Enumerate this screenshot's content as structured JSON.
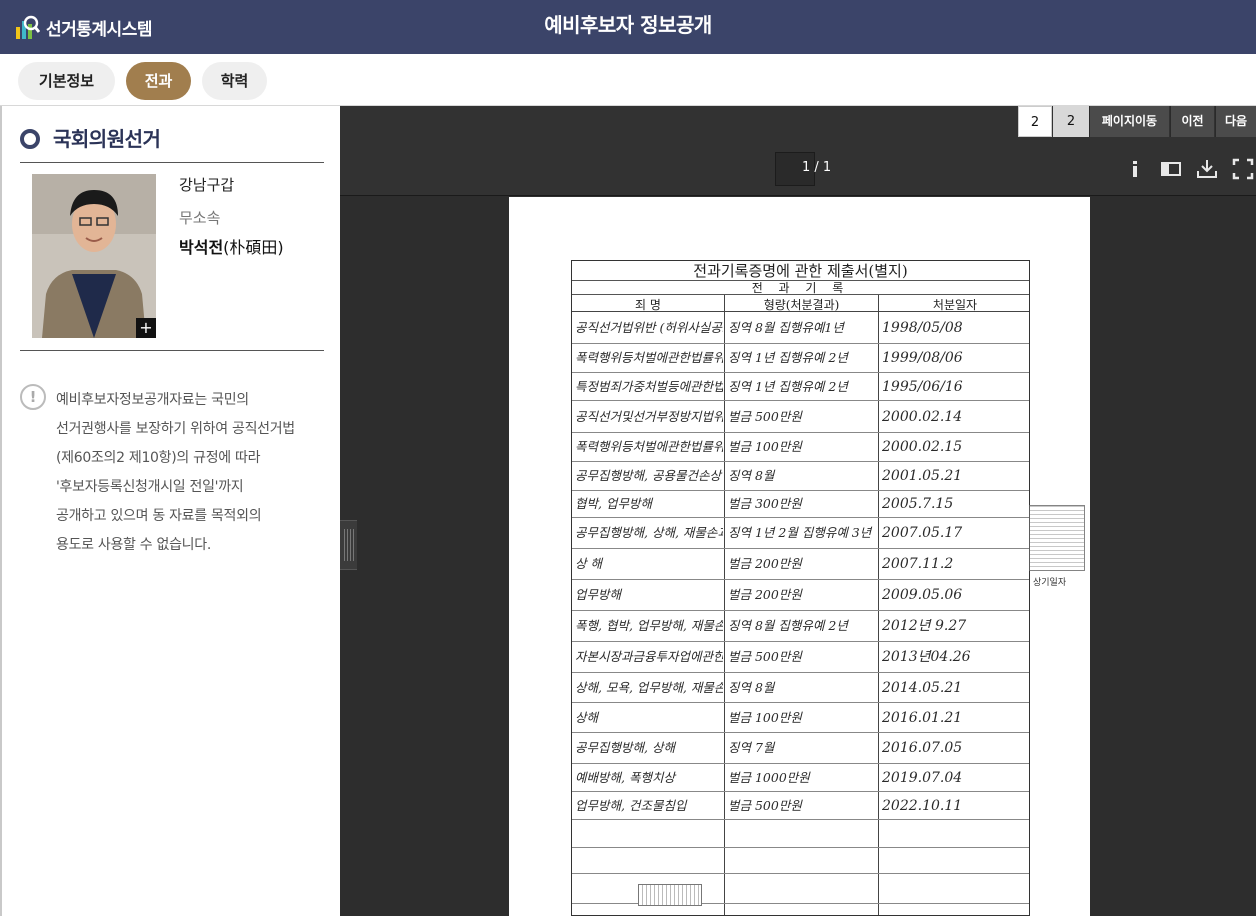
{
  "app": {
    "logo_text": "선거통계시스템",
    "page_title": "예비후보자 정보공개"
  },
  "tabs": [
    {
      "label": "기본정보",
      "active": false
    },
    {
      "label": "전과",
      "active": true
    },
    {
      "label": "학력",
      "active": false
    }
  ],
  "colors": {
    "header_bg": "#3b4469",
    "tab_active": "#a17e4e",
    "viewer_bg": "#2d2d2d"
  },
  "candidate": {
    "election": "국회의원선거",
    "district": "강남구갑",
    "party": "무소속",
    "name": "박석전",
    "name_hanja": "(朴碩田)",
    "photo_icon": "plus-icon"
  },
  "notice": {
    "icon": "exclamation-icon",
    "lines": [
      "예비후보자정보공개자료는 국민의",
      "선거권행사를 보장하기 위하여 공직선거법",
      "(제60조의2 제10항)의 규정에 따라",
      "'후보자등록신청개시일 전일'까지",
      "공개하고 있으며 동 자료를 목적외의",
      "용도로 사용할 수 없습니다."
    ]
  },
  "viewer": {
    "page_input": "2",
    "page_total": "2",
    "goto_label": "페이지이동",
    "prev_label": "이전",
    "next_label": "다음",
    "page_indicator": "1 / 1",
    "tools": [
      "info-icon",
      "sidebar-toggle-icon",
      "download-icon",
      "fullscreen-icon"
    ]
  },
  "document": {
    "title": "전과기록증명에 관한 제출서(별지)",
    "subtitle": "전 과 기 록",
    "columns": [
      "죄 명",
      "형량(처분결과)",
      "처분일자"
    ],
    "rows": [
      {
        "crime": "공직선거법위반 (허위사실공표)",
        "sentence": "징역 8월 집행유예1년",
        "date": "1998/05/08"
      },
      {
        "crime": "폭력행위등처벌에관한법률위반",
        "sentence": "징역 1년 집행유예 2년",
        "date": "1999/08/06"
      },
      {
        "crime": "특정범죄가중처벌등에관한법률위반(도주차량)",
        "sentence": "징역 1년 집행유예 2년",
        "date": "1995/06/16"
      },
      {
        "crime": "공직선거및선거부정방지법위반",
        "sentence": "벌금 500만원",
        "date": "2000.02.14"
      },
      {
        "crime": "폭력행위등처벌에관한법률위반",
        "sentence": "벌금 100만원",
        "date": "2000.02.15"
      },
      {
        "crime": "공무집행방해, 공용물건손상",
        "sentence": "징역 8월",
        "date": "2001.05.21"
      },
      {
        "crime": "협박, 업무방해",
        "sentence": "벌금 300만원",
        "date": "2005.7.15"
      },
      {
        "crime": "공무집행방해, 상해, 재물손괴",
        "sentence": "징역 1년 2월 집행유예 3년",
        "date": "2007.05.17"
      },
      {
        "crime": "상 해",
        "sentence": "벌금 200만원",
        "date": "2007.11.2"
      },
      {
        "crime": "업무방해",
        "sentence": "벌금 200만원",
        "date": "2009.05.06"
      },
      {
        "crime": "폭행, 협박, 업무방해, 재물손괴",
        "sentence": "징역 8월 집행유예 2년",
        "date": "2012년 9.27"
      },
      {
        "crime": "자본시장과금융투자업에관한법률위반",
        "sentence": "벌금 500만원",
        "date": "2013년04.26"
      },
      {
        "crime": "상해, 모욕, 업무방해, 재물손괴",
        "sentence": "징역 8월",
        "date": "2014.05.21"
      },
      {
        "crime": "상해",
        "sentence": "벌금 100만원",
        "date": "2016.01.21"
      },
      {
        "crime": "공무집행방해, 상해",
        "sentence": "징역 7월",
        "date": "2016.07.05"
      },
      {
        "crime": "예배방해, 폭행치상",
        "sentence": "벌금 1000만원",
        "date": "2019.07.04"
      },
      {
        "crime": "업무방해, 건조물침입",
        "sentence": "벌금 500만원",
        "date": "2022.10.11"
      }
    ],
    "seal_label": "상기일자"
  }
}
